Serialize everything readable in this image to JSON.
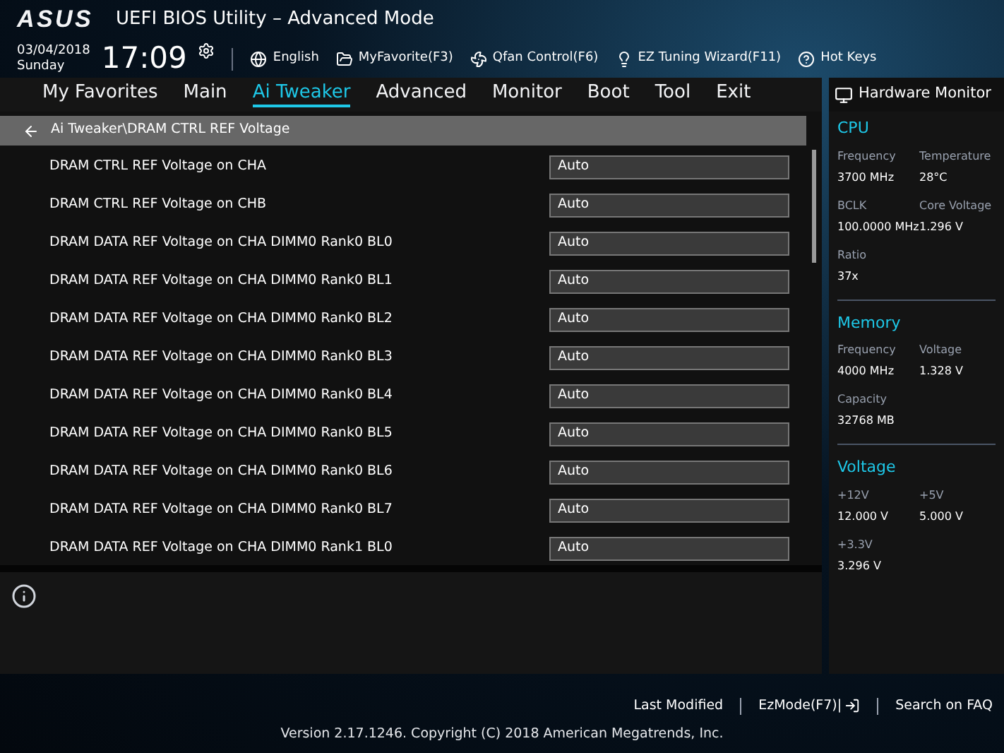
{
  "header": {
    "logo": "ASUS",
    "title": "UEFI BIOS Utility – Advanced Mode",
    "date": "03/04/2018",
    "day": "Sunday",
    "time": "17:09",
    "tools": [
      {
        "kind": "globe",
        "label": "English"
      },
      {
        "kind": "favorite",
        "label": "MyFavorite(F3)"
      },
      {
        "kind": "fan",
        "label": "Qfan Control(F6)"
      },
      {
        "kind": "bulb",
        "label": "EZ Tuning Wizard(F11)"
      },
      {
        "kind": "help",
        "label": "Hot Keys"
      }
    ]
  },
  "tabs": [
    {
      "label": "My Favorites",
      "selected": false
    },
    {
      "label": "Main",
      "selected": false
    },
    {
      "label": "Ai Tweaker",
      "selected": true
    },
    {
      "label": "Advanced",
      "selected": false
    },
    {
      "label": "Monitor",
      "selected": false
    },
    {
      "label": "Boot",
      "selected": false
    },
    {
      "label": "Tool",
      "selected": false
    },
    {
      "label": "Exit",
      "selected": false
    }
  ],
  "breadcrumb": "Ai Tweaker\\DRAM CTRL REF Voltage",
  "settings": [
    {
      "label": "DRAM CTRL REF Voltage on CHA",
      "value": "Auto"
    },
    {
      "label": "DRAM CTRL REF Voltage on CHB",
      "value": "Auto"
    },
    {
      "label": "DRAM DATA REF Voltage on CHA DIMM0 Rank0 BL0",
      "value": "Auto"
    },
    {
      "label": "DRAM DATA REF Voltage on CHA DIMM0 Rank0 BL1",
      "value": "Auto"
    },
    {
      "label": "DRAM DATA REF Voltage on CHA DIMM0 Rank0 BL2",
      "value": "Auto"
    },
    {
      "label": "DRAM DATA REF Voltage on CHA DIMM0 Rank0 BL3",
      "value": "Auto"
    },
    {
      "label": "DRAM DATA REF Voltage on CHA DIMM0 Rank0 BL4",
      "value": "Auto"
    },
    {
      "label": "DRAM DATA REF Voltage on CHA DIMM0 Rank0 BL5",
      "value": "Auto"
    },
    {
      "label": "DRAM DATA REF Voltage on CHA DIMM0 Rank0 BL6",
      "value": "Auto"
    },
    {
      "label": "DRAM DATA REF Voltage on CHA DIMM0 Rank0 BL7",
      "value": "Auto"
    },
    {
      "label": "DRAM DATA REF Voltage on CHA DIMM0 Rank1 BL0",
      "value": "Auto"
    }
  ],
  "hardware_monitor": {
    "title": "Hardware Monitor",
    "sections": [
      {
        "title": "CPU",
        "items": [
          {
            "label": "Frequency",
            "value": "3700 MHz"
          },
          {
            "label": "Temperature",
            "value": "28°C"
          },
          {
            "label": "BCLK",
            "value": "100.0000 MHz"
          },
          {
            "label": "Core Voltage",
            "value": "1.296 V"
          },
          {
            "label": "Ratio",
            "value": "37x"
          }
        ]
      },
      {
        "title": "Memory",
        "items": [
          {
            "label": "Frequency",
            "value": "4000 MHz"
          },
          {
            "label": "Voltage",
            "value": "1.328 V"
          },
          {
            "label": "Capacity",
            "value": "32768 MB"
          }
        ]
      },
      {
        "title": "Voltage",
        "items": [
          {
            "label": "+12V",
            "value": "12.000 V"
          },
          {
            "label": "+5V",
            "value": "5.000 V"
          },
          {
            "label": "+3.3V",
            "value": "3.296 V"
          }
        ]
      }
    ]
  },
  "footer": {
    "links": [
      {
        "kind": "plain",
        "label": "Last Modified"
      },
      {
        "kind": "exit",
        "label": "EzMode(F7)|"
      },
      {
        "kind": "plain",
        "label": "Search on FAQ"
      }
    ],
    "version": "Version 2.17.1246. Copyright (C) 2018 American Megatrends, Inc."
  }
}
